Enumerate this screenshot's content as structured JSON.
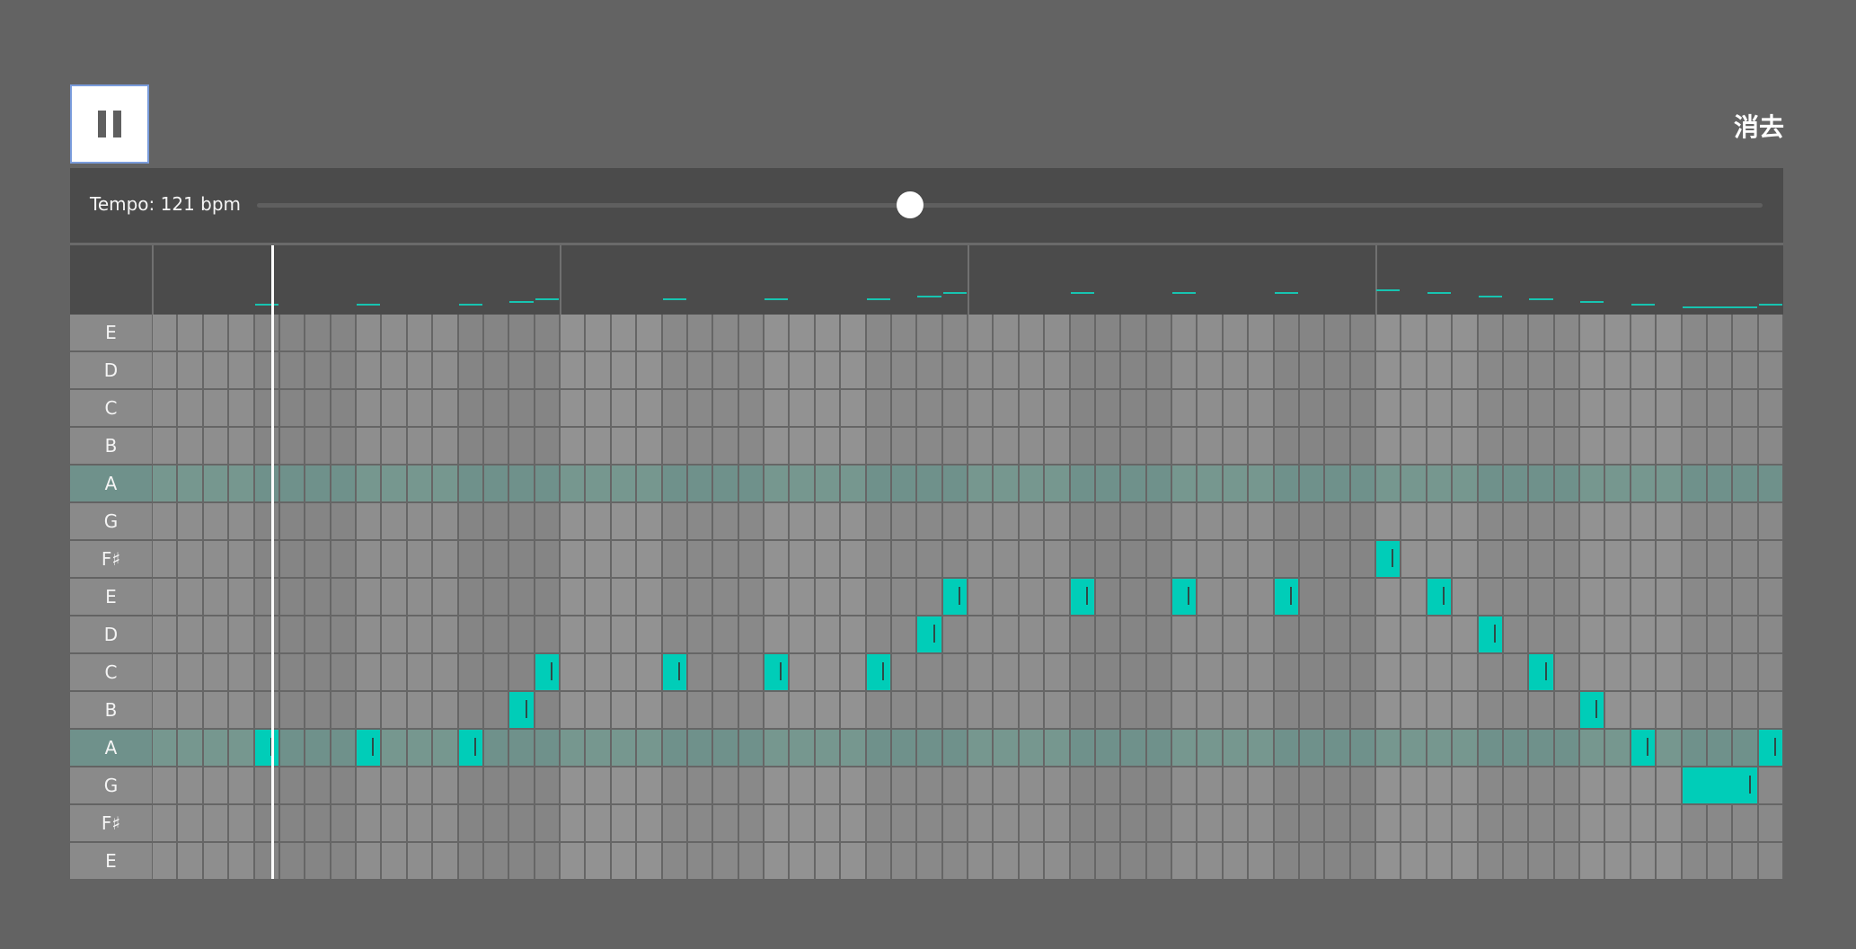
{
  "controls": {
    "pause_icon": "pause-icon",
    "clear_label": "消去"
  },
  "tempo": {
    "label": "Tempo: 121 bpm",
    "value": 121,
    "slider_fraction": 0.434
  },
  "grid": {
    "rows": [
      "E",
      "D",
      "C",
      "B",
      "A",
      "G",
      "F♯",
      "E",
      "D",
      "C",
      "B",
      "A",
      "G",
      "F♯",
      "E"
    ],
    "highlighted_rows": [
      4,
      11
    ],
    "steps": 64,
    "steps_per_bar": 16,
    "playhead_step": 4.7,
    "notes": [
      {
        "row": 11,
        "step": 4,
        "length": 1
      },
      {
        "row": 11,
        "step": 8,
        "length": 1
      },
      {
        "row": 11,
        "step": 12,
        "length": 1
      },
      {
        "row": 10,
        "step": 14,
        "length": 1
      },
      {
        "row": 9,
        "step": 15,
        "length": 1
      },
      {
        "row": 9,
        "step": 20,
        "length": 1
      },
      {
        "row": 9,
        "step": 24,
        "length": 1
      },
      {
        "row": 9,
        "step": 28,
        "length": 1
      },
      {
        "row": 8,
        "step": 30,
        "length": 1
      },
      {
        "row": 7,
        "step": 31,
        "length": 1
      },
      {
        "row": 7,
        "step": 36,
        "length": 1
      },
      {
        "row": 7,
        "step": 40,
        "length": 1
      },
      {
        "row": 7,
        "step": 44,
        "length": 1
      },
      {
        "row": 6,
        "step": 48,
        "length": 1
      },
      {
        "row": 7,
        "step": 50,
        "length": 1
      },
      {
        "row": 8,
        "step": 52,
        "length": 1
      },
      {
        "row": 9,
        "step": 54,
        "length": 1
      },
      {
        "row": 10,
        "step": 56,
        "length": 1
      },
      {
        "row": 11,
        "step": 58,
        "length": 1
      },
      {
        "row": 12,
        "step": 60,
        "length": 3
      },
      {
        "row": 11,
        "step": 63,
        "length": 1
      }
    ]
  },
  "colors": {
    "background": "#636363",
    "panel": "#4b4b4b",
    "note": "#00cdb8",
    "highlight_row": "#6f918b",
    "cell_light": "#8e8e8e",
    "cell_dark": "#858585",
    "grid_line": "#666666"
  }
}
